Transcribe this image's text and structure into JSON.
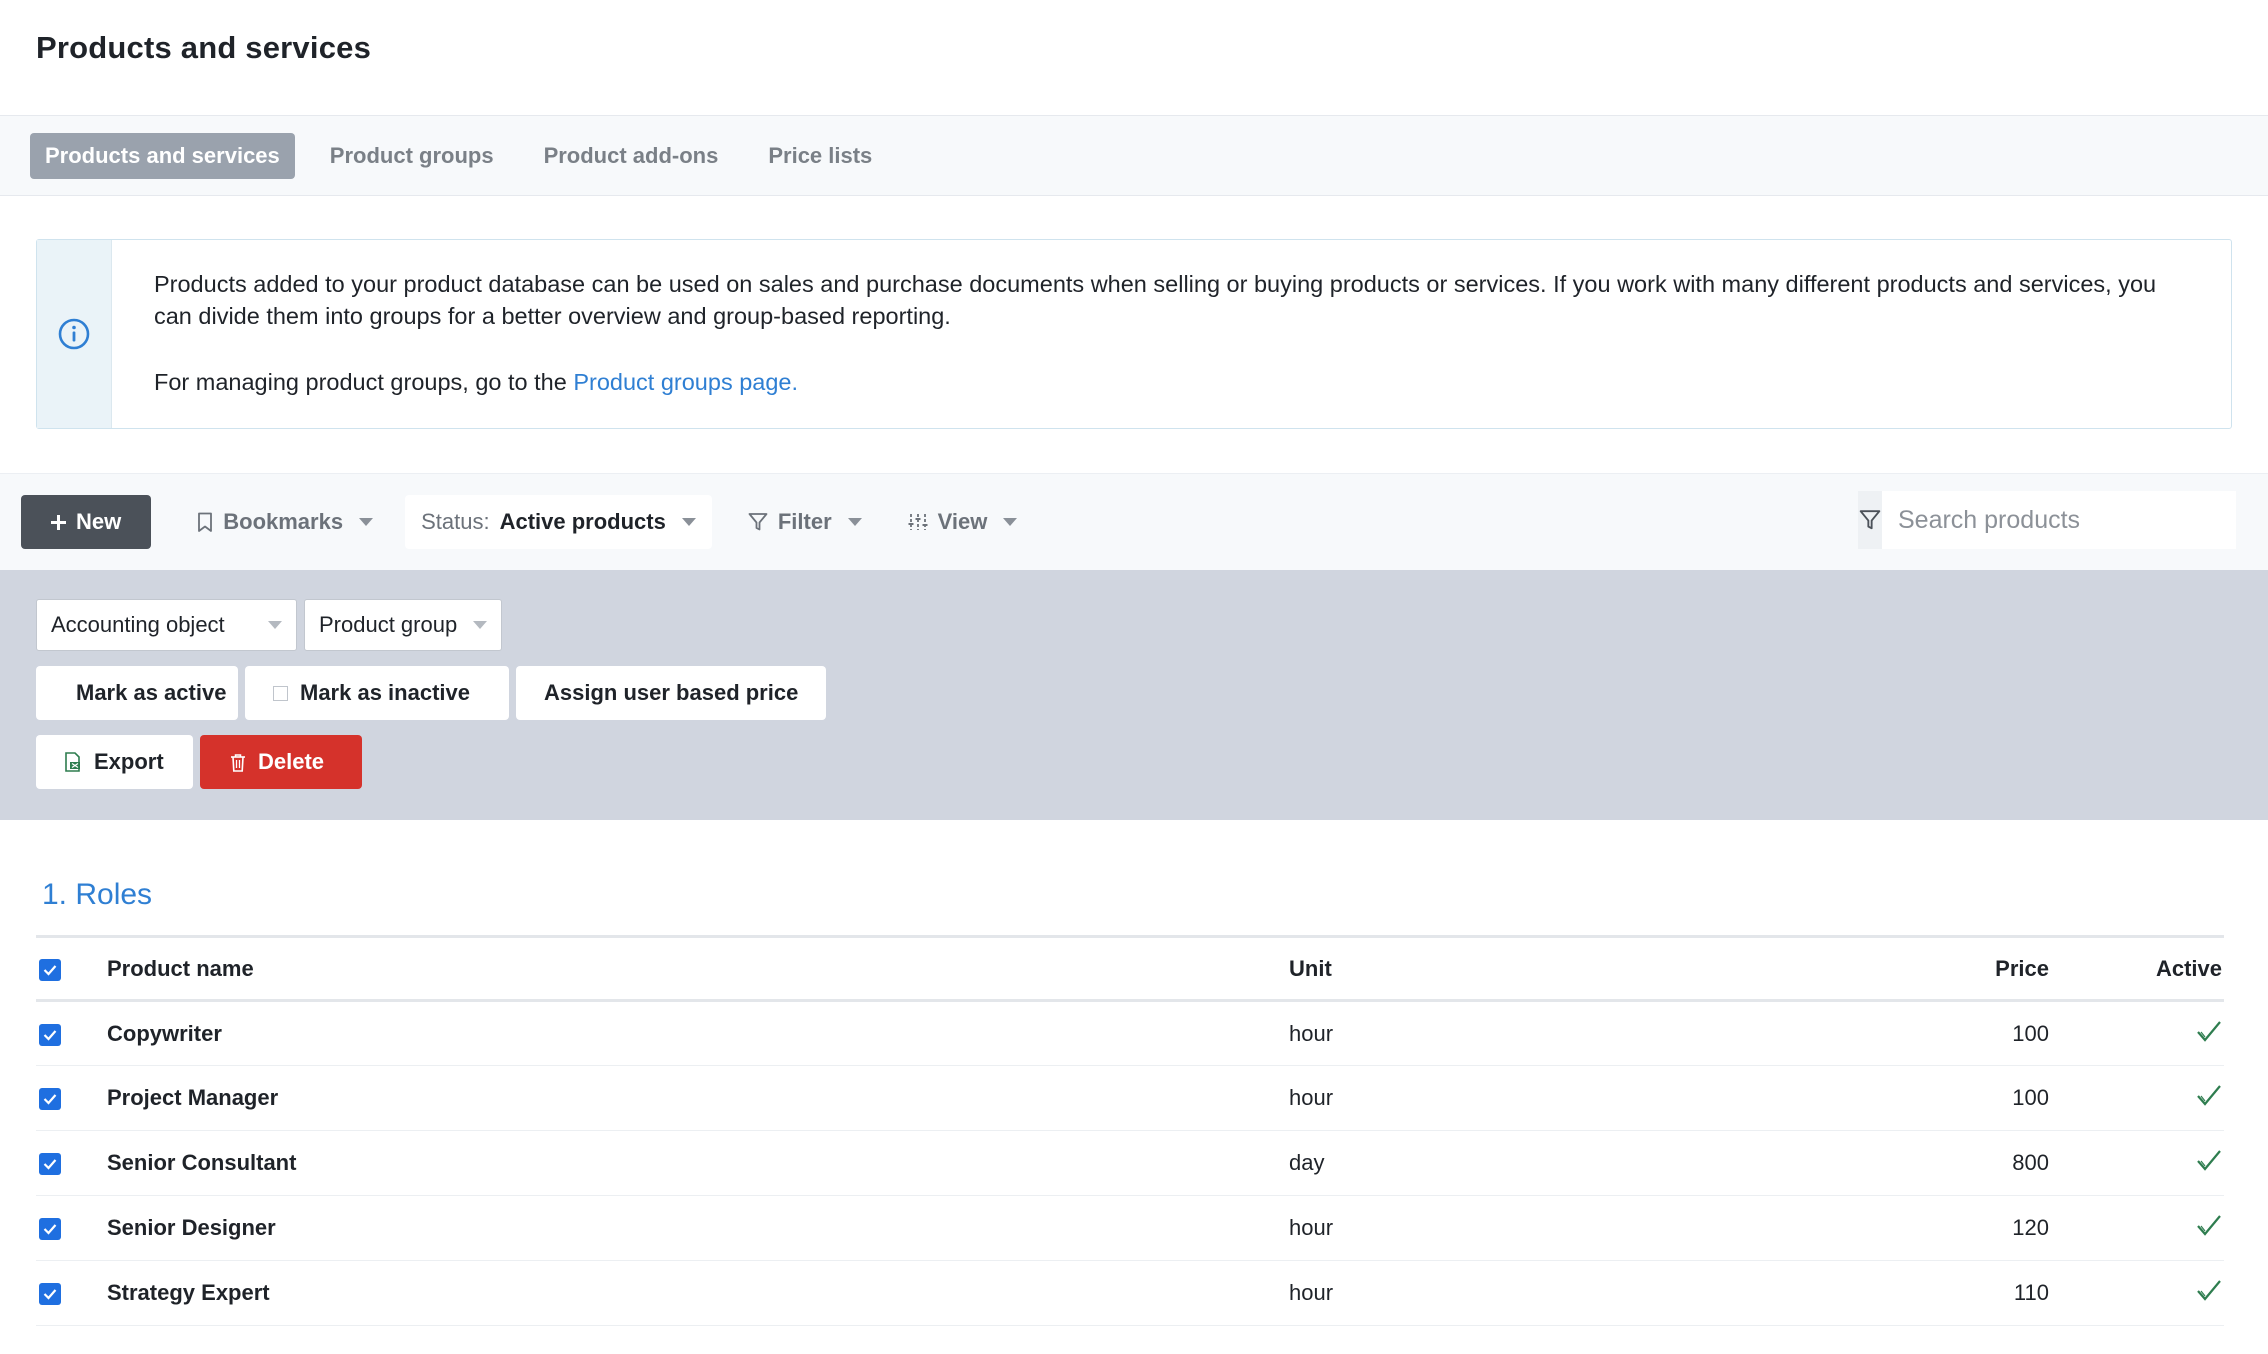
{
  "header": {
    "title": "Products and services"
  },
  "tabs": [
    {
      "label": "Products and services",
      "active": true
    },
    {
      "label": "Product groups",
      "active": false
    },
    {
      "label": "Product add-ons",
      "active": false
    },
    {
      "label": "Price lists",
      "active": false
    }
  ],
  "info": {
    "icon": "info-icon",
    "paragraph1": "Products added to your product database can be used on sales and purchase documents when selling or buying products or services. If you work with many different products and services, you can divide them into groups for a better overview and group-based reporting.",
    "paragraph2_prefix": "For managing product groups, go to the ",
    "paragraph2_link": "Product groups page."
  },
  "toolbar": {
    "new_label": "New",
    "bookmarks_label": "Bookmarks",
    "status_prefix": "Status: ",
    "status_value": "Active products",
    "filter_label": "Filter",
    "view_label": "View",
    "search_placeholder": "Search products"
  },
  "actions": {
    "accounting_object": "Accounting object",
    "product_group": "Product group",
    "mark_active": "Mark as active",
    "mark_inactive": "Mark as inactive",
    "assign_price": "Assign user based price",
    "export": "Export",
    "delete": "Delete"
  },
  "section": {
    "title": "1. Roles",
    "columns": {
      "name": "Product name",
      "unit": "Unit",
      "price": "Price",
      "active": "Active"
    },
    "rows": [
      {
        "name": "Copywriter",
        "unit": "hour",
        "price": "100",
        "active": true
      },
      {
        "name": "Project Manager",
        "unit": "hour",
        "price": "100",
        "active": true
      },
      {
        "name": "Senior Consultant",
        "unit": "day",
        "price": "800",
        "active": true
      },
      {
        "name": "Senior Designer",
        "unit": "hour",
        "price": "120",
        "active": true
      },
      {
        "name": "Strategy Expert",
        "unit": "hour",
        "price": "110",
        "active": true
      }
    ]
  },
  "colors": {
    "accent": "#2f7fd3",
    "checkbox": "#1f6fe0",
    "delete": "#d5322b",
    "new_button": "#4b5159",
    "active_check": "#2e7d4f"
  }
}
